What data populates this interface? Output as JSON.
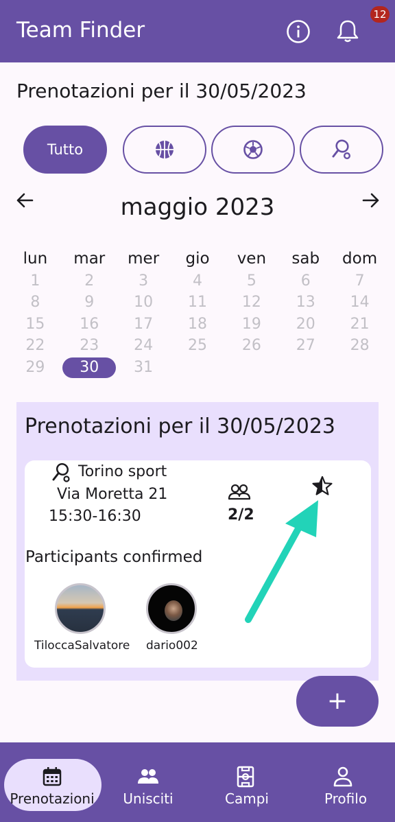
{
  "app": {
    "title": "Team Finder",
    "notification_count": "12"
  },
  "header": {
    "title": "Prenotazioni per il 30/05/2023"
  },
  "filters": [
    {
      "label": "Tutto",
      "active": true
    },
    {
      "icon": "basketball-icon"
    },
    {
      "icon": "soccer-ball-icon"
    },
    {
      "icon": "tennis-racket-icon"
    }
  ],
  "calendar": {
    "month": "maggio 2023",
    "weekdays": [
      "lun",
      "mar",
      "mer",
      "gio",
      "ven",
      "sab",
      "dom"
    ],
    "weeks": [
      [
        "1",
        "2",
        "3",
        "4",
        "5",
        "6",
        "7"
      ],
      [
        "8",
        "9",
        "10",
        "11",
        "12",
        "13",
        "14"
      ],
      [
        "15",
        "16",
        "17",
        "18",
        "19",
        "20",
        "21"
      ],
      [
        "22",
        "23",
        "24",
        "25",
        "26",
        "27",
        "28"
      ],
      [
        "29",
        "30",
        "31",
        "",
        "",
        "",
        ""
      ]
    ],
    "selected": "30"
  },
  "bookings": {
    "title": "Prenotazioni per il 30/05/2023",
    "card": {
      "venue": "Torino sport",
      "address": "Via Moretta 21",
      "time": "15:30-16:30",
      "players": "2/2",
      "participants_title": "Participants confirmed",
      "participants": [
        {
          "name": "TiloccaSalvatore"
        },
        {
          "name": "dario002"
        }
      ]
    }
  },
  "fab": {
    "label": "+"
  },
  "nav": [
    {
      "label": "Prenotazioni",
      "icon": "calendar-icon",
      "active": true
    },
    {
      "label": "Unisciti",
      "icon": "group-icon"
    },
    {
      "label": "Campi",
      "icon": "field-icon"
    },
    {
      "label": "Profilo",
      "icon": "person-icon"
    }
  ],
  "colors": {
    "primary": "#6750a4",
    "container": "#e9dffd",
    "badge": "#b3261e",
    "arrow": "#22d3b8"
  }
}
